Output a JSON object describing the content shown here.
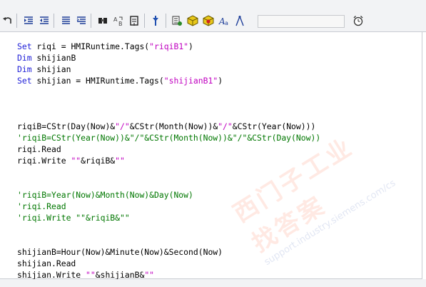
{
  "toolbar": {
    "buttons": [
      {
        "icon": "undo-icon"
      },
      {
        "icon": "indent-icon"
      },
      {
        "icon": "outdent-icon"
      },
      {
        "icon": "comment-icon"
      },
      {
        "icon": "uncomment-icon"
      },
      {
        "icon": "find-icon"
      },
      {
        "icon": "replace-icon"
      },
      {
        "icon": "goto-icon"
      },
      {
        "icon": "syntax-check-icon"
      },
      {
        "icon": "object-list-icon"
      },
      {
        "icon": "cube-icon"
      },
      {
        "icon": "cube-star-icon"
      },
      {
        "icon": "font-icon"
      },
      {
        "icon": "compass-icon"
      },
      {
        "icon": "alarm-clock-icon"
      }
    ],
    "search_value": ""
  },
  "code": {
    "lines": [
      [
        {
          "t": "Set",
          "c": "kw"
        },
        {
          "t": " riqi = HMIRuntime.Tags("
        },
        {
          "t": "\"riqiB1\"",
          "c": "str"
        },
        {
          "t": ")"
        }
      ],
      [
        {
          "t": "Dim",
          "c": "kw"
        },
        {
          "t": " shijianB"
        }
      ],
      [
        {
          "t": "Dim",
          "c": "kw"
        },
        {
          "t": " shijian"
        }
      ],
      [
        {
          "t": "Set",
          "c": "kw"
        },
        {
          "t": " shijian = HMIRuntime.Tags("
        },
        {
          "t": "\"shijianB1\"",
          "c": "str"
        },
        {
          "t": ")"
        }
      ],
      [],
      [],
      [],
      [
        {
          "t": "riqiB=CStr(Day(Now)&"
        },
        {
          "t": "\"/\"",
          "c": "str"
        },
        {
          "t": "&CStr(Month(Now))&"
        },
        {
          "t": "\"/\"",
          "c": "str"
        },
        {
          "t": "&CStr(Year(Now)))"
        }
      ],
      [
        {
          "t": "'riqiB=CStr(Year(Now))&\"/\"&CStr(Month(Now))&\"/\"&CStr(Day(Now))",
          "c": "cm"
        }
      ],
      [
        {
          "t": "riqi.Read"
        }
      ],
      [
        {
          "t": "riqi.Write "
        },
        {
          "t": "\"\"",
          "c": "str"
        },
        {
          "t": "&riqiB&"
        },
        {
          "t": "\"\"",
          "c": "str"
        }
      ],
      [],
      [],
      [
        {
          "t": "'riqiB=Year(Now)&Month(Now)&Day(Now)",
          "c": "cm"
        }
      ],
      [
        {
          "t": "'riqi.Read",
          "c": "cm"
        }
      ],
      [
        {
          "t": "'riqi.Write \"\"&riqiB&\"\"",
          "c": "cm"
        }
      ],
      [],
      [],
      [
        {
          "t": "shijianB=Hour(Now)&Minute(Now)&Second(Now)"
        }
      ],
      [
        {
          "t": "shijian.Read"
        }
      ],
      [
        {
          "t": "shijian.Write "
        },
        {
          "t": "\"\"",
          "c": "str"
        },
        {
          "t": "&shijianB&"
        },
        {
          "t": "\"\"",
          "c": "str"
        }
      ]
    ]
  },
  "watermark": {
    "big": "西门子工业找答案",
    "small": "support.industry.siemens.com/cs"
  },
  "colors": {
    "keyword": "#2020d8",
    "string": "#c000c0",
    "comment": "#007700"
  }
}
